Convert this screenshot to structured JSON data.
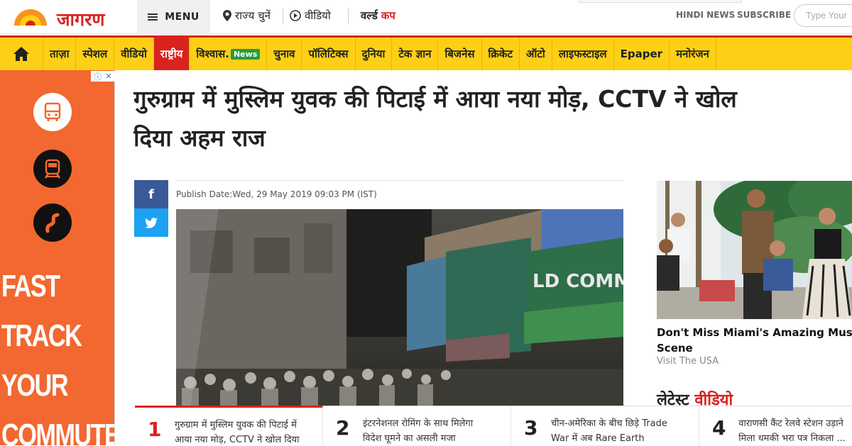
{
  "header": {
    "logo_text": "जागरण",
    "menu_label": "MENU",
    "state_label": "राज्य चुनें",
    "video_label": "वीडियो",
    "worldcup_label_1": "वर्ल्ड",
    "worldcup_label_2": "कप",
    "hindi_news": "HINDI NEWS",
    "subscribe": "SUBSCRIBE",
    "search_placeholder": "Type Your"
  },
  "nav": {
    "items": [
      "ताज़ा",
      "स्पेशल",
      "वीडियो",
      "राष्ट्रीय",
      "विश्वास.",
      "चुनाव",
      "पॉलिटिक्स",
      "दुनिया",
      "टेक ज्ञान",
      "बिजनेस",
      "क्रिकेट",
      "ऑटो",
      "लाइफस्टाइल",
      "Epaper",
      "मनोरंजन"
    ],
    "news_pill": "News",
    "active_index": 3
  },
  "ad": {
    "words": [
      "FAST",
      "TRACK",
      "YOUR",
      "COMMUTE"
    ]
  },
  "article": {
    "headline_line1": "गुरुग्राम में मुस्लिम युवक की पिटाई में आया नया मोड़, CCTV ने खोल",
    "headline_line2": "दिया अहम राज",
    "publish": "Publish Date:Wed, 29 May 2019 09:03 PM (IST)",
    "image_shop_sign": "LD COMM"
  },
  "sidebar": {
    "promo_title_line1": "Don't Miss Miami's Amazing Musi",
    "promo_title_line2": "Scene",
    "promo_source": "Visit The USA",
    "latest_1": "लेटेस्ट",
    "latest_2": "वीडियो"
  },
  "trending": [
    {
      "num": "1",
      "line1": "गुरुग्राम में मुस्लिम युवक की पिटाई में",
      "line2": "आया नया मोड़, CCTV ने खोल दिया"
    },
    {
      "num": "2",
      "line1": "इंटरनेशनल रोमिंग के साथ मिलेगा",
      "line2": "विदेश घूमने का असली मजा"
    },
    {
      "num": "3",
      "line1": "चीन-अमेरिका के बीच छिड़े Trade",
      "line2": "War में अब Rare Earth"
    },
    {
      "num": "4",
      "line1": "वाराणसी कैंट रेलवे स्टेशन उड़ाने",
      "line2": "मिला धमकी भरा पत्र निकला ..."
    }
  ]
}
